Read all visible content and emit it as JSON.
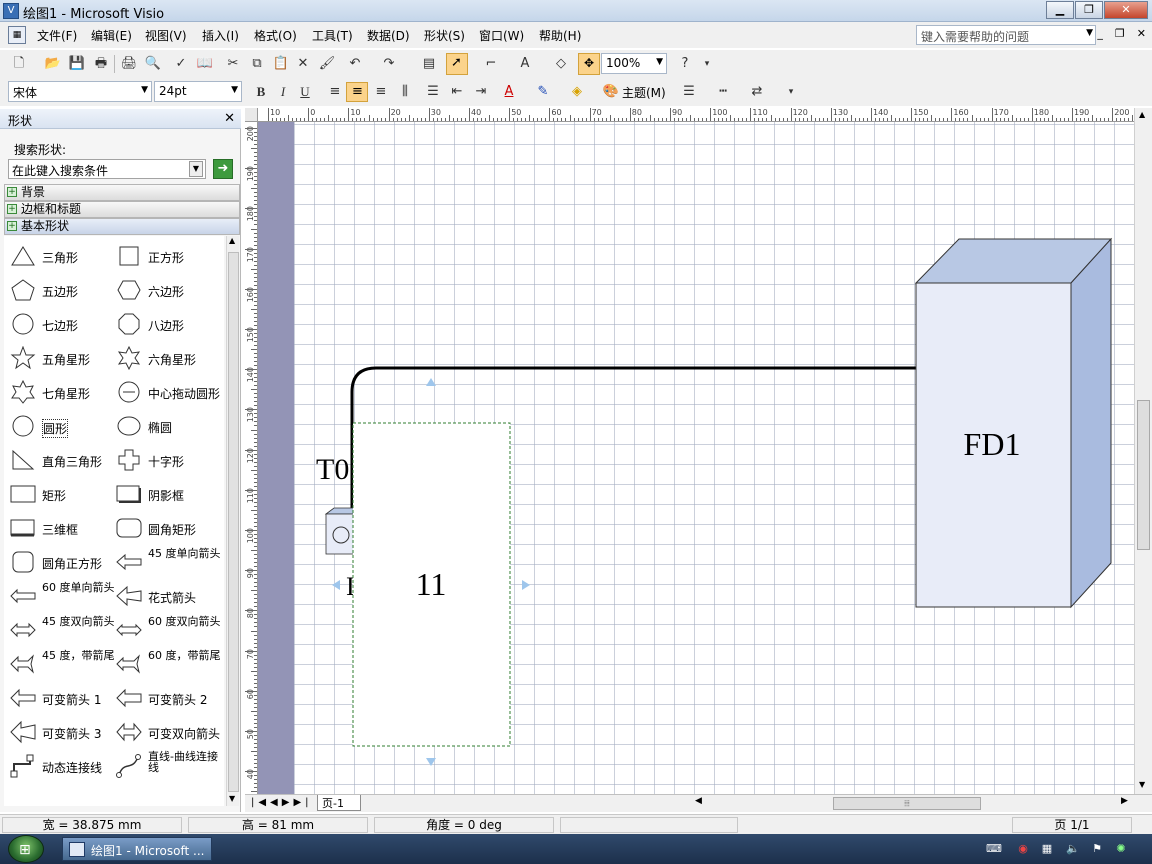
{
  "window": {
    "title": "绘图1 - Microsoft Visio",
    "minimize": "▁",
    "maximize": "❐",
    "close": "✕"
  },
  "menu": {
    "items": [
      "文件(F)",
      "编辑(E)",
      "视图(V)",
      "插入(I)",
      "格式(O)",
      "工具(T)",
      "数据(D)",
      "形状(S)",
      "窗口(W)",
      "帮助(H)"
    ],
    "help_placeholder": "键入需要帮助的问题",
    "mdi_min": "_",
    "mdi_restore": "❐",
    "mdi_close": "✕"
  },
  "toolbar": {
    "zoom": "100%",
    "font_name": "宋体",
    "font_size": "24pt",
    "bold": "B",
    "italic": "I",
    "underline": "U",
    "theme_label": "主题(M)"
  },
  "shapes_panel": {
    "title": "形状",
    "search_label": "搜索形状:",
    "search_placeholder": "在此键入搜索条件",
    "stencils": [
      "背景",
      "边框和标题",
      "基本形状"
    ],
    "shapes": [
      {
        "label": "三角形",
        "icon": "triangle-icon"
      },
      {
        "label": "正方形",
        "icon": "square-icon"
      },
      {
        "label": "五边形",
        "icon": "pentagon-icon"
      },
      {
        "label": "六边形",
        "icon": "hexagon-icon"
      },
      {
        "label": "七边形",
        "icon": "heptagon-icon"
      },
      {
        "label": "八边形",
        "icon": "octagon-icon"
      },
      {
        "label": "五角星形",
        "icon": "star5-icon"
      },
      {
        "label": "六角星形",
        "icon": "star6-icon"
      },
      {
        "label": "七角星形",
        "icon": "star7-icon"
      },
      {
        "label": "中心拖动圆形",
        "icon": "center-circle-icon"
      },
      {
        "label": "圆形",
        "icon": "circle-icon"
      },
      {
        "label": "椭圆",
        "icon": "ellipse-icon"
      },
      {
        "label": "直角三角形",
        "icon": "right-triangle-icon"
      },
      {
        "label": "十字形",
        "icon": "cross-icon"
      },
      {
        "label": "矩形",
        "icon": "rectangle-icon"
      },
      {
        "label": "阴影框",
        "icon": "shadow-box-icon"
      },
      {
        "label": "三维框",
        "icon": "3d-box-icon"
      },
      {
        "label": "圆角矩形",
        "icon": "rounded-rect-icon"
      },
      {
        "label": "圆角正方形",
        "icon": "rounded-square-icon"
      },
      {
        "label": "45 度单向箭头",
        "icon": "arrow45-icon"
      },
      {
        "label": "60 度单向箭头",
        "icon": "arrow60-icon"
      },
      {
        "label": "花式箭头",
        "icon": "fancy-arrow-icon"
      },
      {
        "label": "45 度双向箭头",
        "icon": "double-arrow45-icon"
      },
      {
        "label": "60 度双向箭头",
        "icon": "double-arrow60-icon"
      },
      {
        "label": "45 度，带箭尾",
        "icon": "tailed-arrow45-icon"
      },
      {
        "label": "60 度，带箭尾",
        "icon": "tailed-arrow60-icon"
      },
      {
        "label": "可变箭头 1",
        "icon": "flex-arrow1-icon"
      },
      {
        "label": "可变箭头 2",
        "icon": "flex-arrow2-icon"
      },
      {
        "label": "可变箭头 3",
        "icon": "flex-arrow3-icon"
      },
      {
        "label": "可变双向箭头",
        "icon": "flex-double-arrow-icon"
      },
      {
        "label": "动态连接线",
        "icon": "dynamic-connector-icon"
      },
      {
        "label": "直线-曲线连接线",
        "icon": "line-curve-connector-icon"
      }
    ]
  },
  "rulers": {
    "horizontal_ticks": [
      "10",
      "0",
      "10",
      "20",
      "30",
      "40",
      "50",
      "60",
      "70",
      "80",
      "90",
      "100",
      "110",
      "120",
      "130",
      "140",
      "150",
      "160",
      "170",
      "180",
      "190",
      "200"
    ],
    "vertical_ticks": [
      "200",
      "190",
      "180",
      "170",
      "160",
      "150",
      "140",
      "130",
      "120",
      "110",
      "100",
      "90",
      "80",
      "70",
      "60",
      "50",
      "40"
    ]
  },
  "canvas": {
    "label_t0": "T0",
    "label_r": "I",
    "rect_text": "11",
    "box3d_text": "FD1",
    "colors": {
      "box_front": "#e8ecf8",
      "box_top": "#b8c8e4",
      "box_side": "#a9bbdf",
      "selection": "#2f7d2f",
      "handle": "#9ec6ec"
    }
  },
  "page_tabs": {
    "tabs": [
      "页-1"
    ]
  },
  "status": {
    "width": "宽 = 38.875 mm",
    "height": "高 = 81 mm",
    "angle": "角度 = 0 deg",
    "page": "页 1/1"
  },
  "taskbar": {
    "window_button": "绘图1 - Microsoft ..."
  }
}
